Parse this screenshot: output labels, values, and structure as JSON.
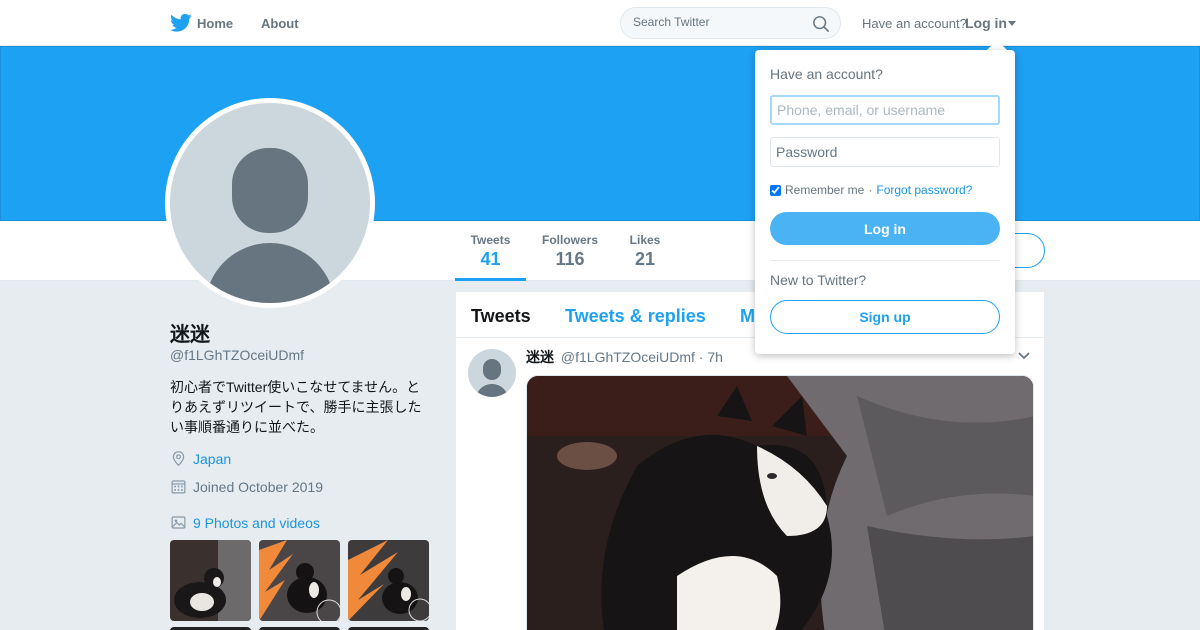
{
  "nav": {
    "logo_icon": "twitter-bird-icon",
    "home_label": "Home",
    "about_label": "About",
    "search_placeholder": "Search Twitter",
    "have_account": "Have an account?",
    "login_label": "Log in"
  },
  "colors": {
    "brand_blue": "#1da1f2",
    "link_blue": "#1b95e0",
    "login_button": "#4ab3f4"
  },
  "profile": {
    "name": "迷迷",
    "handle": "@f1LGhTZOceiUDmf",
    "bio": "初心者でTwitter使いこなせてません。とりあえずリツイートで、勝手に主張したい事順番通りに並べた。",
    "location": "Japan",
    "joined": "Joined October 2019",
    "photos_link": "9 Photos and videos"
  },
  "stats": [
    {
      "label": "Tweets",
      "value": "41"
    },
    {
      "label": "Followers",
      "value": "116"
    },
    {
      "label": "Likes",
      "value": "21"
    }
  ],
  "timeline": {
    "tabs": [
      "Tweets",
      "Tweets & replies",
      "M"
    ],
    "tweet": {
      "name": "迷迷",
      "handle": "@f1LGhTZOceiUDmf",
      "time": "· 7h"
    }
  },
  "login_dropdown": {
    "title": "Have an account?",
    "username_placeholder": "Phone, email, or username",
    "password_placeholder": "Password",
    "remember_me": "Remember me",
    "separator": "·",
    "forgot_password": "Forgot password?",
    "login_button": "Log in",
    "new_prompt": "New to Twitter?",
    "signup_button": "Sign up"
  }
}
